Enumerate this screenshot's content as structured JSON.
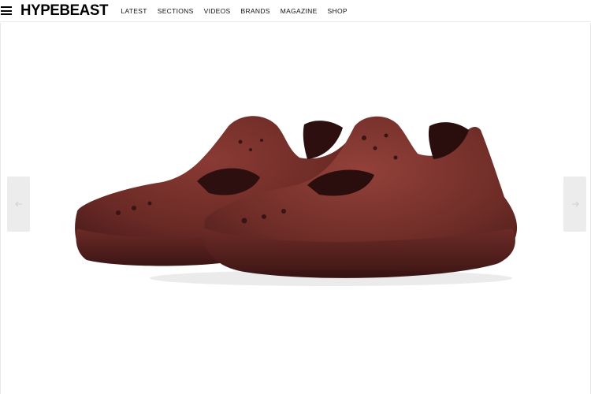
{
  "site": {
    "logo": "HYPEBEAST"
  },
  "nav": {
    "items": [
      "LATEST",
      "SECTIONS",
      "VIDEOS",
      "BRANDS",
      "MAGAZINE",
      "SHOP"
    ]
  },
  "gallery": {
    "image_subject": "brown-clogs",
    "prev_icon": "arrow-left-icon",
    "next_icon": "arrow-right-icon"
  },
  "colors": {
    "shoe": "#6b2a25",
    "shoe_dark": "#3d1412",
    "arrow_bg": "#ececec"
  }
}
